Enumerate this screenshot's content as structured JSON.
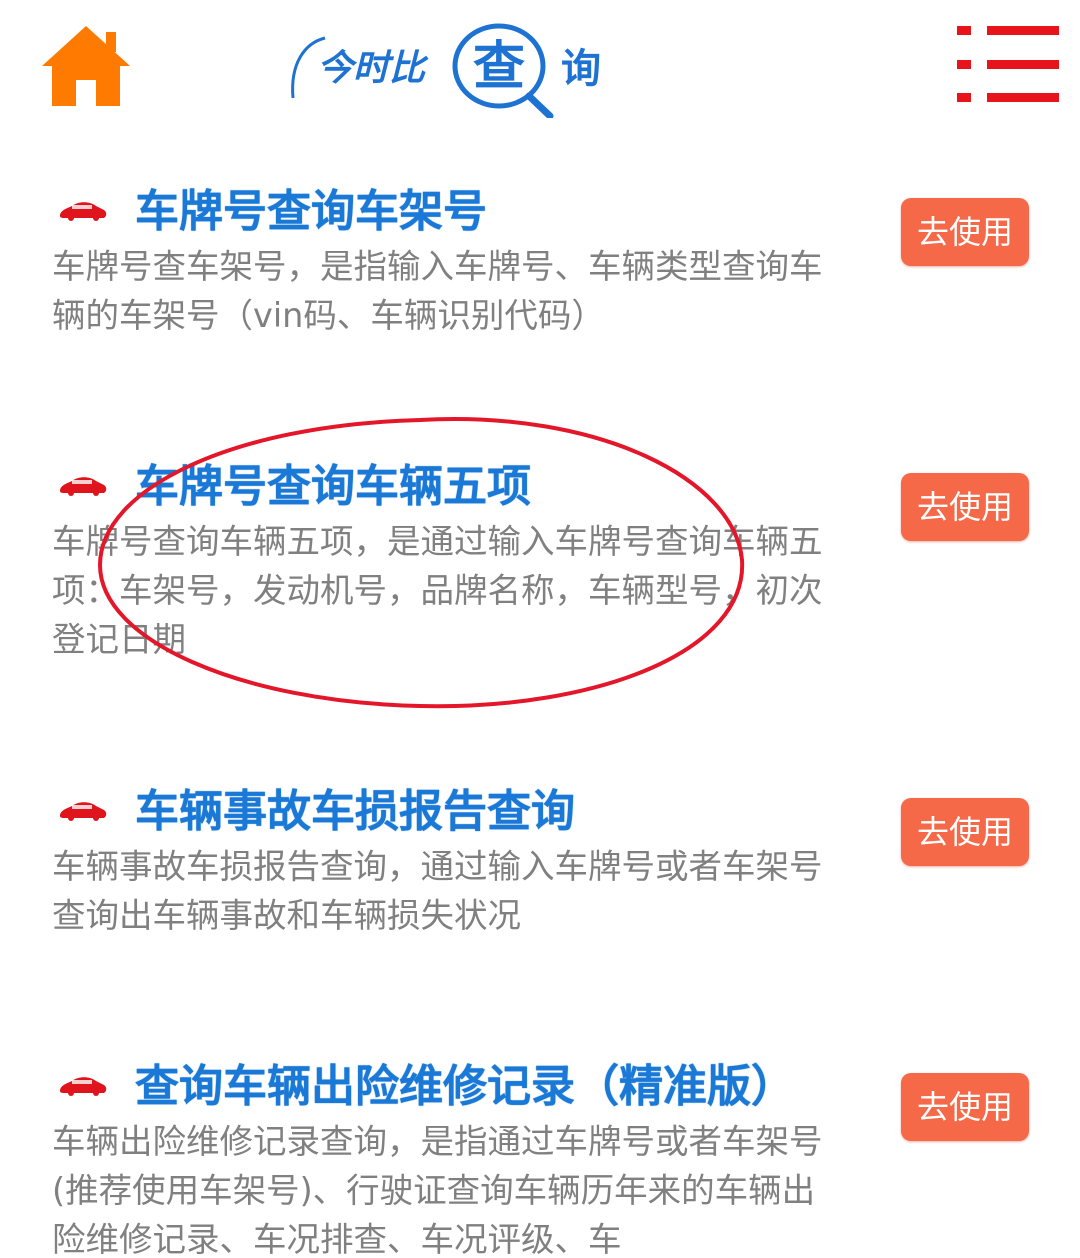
{
  "header": {
    "home_icon": "home-icon",
    "logo": {
      "prefix": "今时比",
      "emblem": "查",
      "suffix": "询"
    },
    "menu_icon": "list-menu-icon"
  },
  "colors": {
    "home": "#ff7a00",
    "logo": "#1e73d2",
    "menu": "#e8141c",
    "title": "#1a78d6",
    "desc": "#808080",
    "button": "#f56848",
    "car": "#e0141c",
    "annotation_circle": "#e4162a"
  },
  "items": [
    {
      "title": "车牌号查询车架号",
      "desc": "车牌号查车架号，是指输入车牌号、车辆类型查询车辆的车架号（vin码、车辆识别代码）",
      "button": "去使用",
      "icon": "red-car-icon"
    },
    {
      "title": "车牌号查询车辆五项",
      "desc": "车牌号查询车辆五项，是通过输入车牌号查询车辆五项：车架号，发动机号，品牌名称，车辆型号，初次登记日期",
      "button": "去使用",
      "icon": "red-car-icon"
    },
    {
      "title": "车辆事故车损报告查询",
      "desc": "车辆事故车损报告查询，通过输入车牌号或者车架号查询出车辆事故和车辆损失状况",
      "button": "去使用",
      "icon": "red-car-icon"
    },
    {
      "title": "查询车辆出险维修记录（精准版）",
      "desc": "车辆出险维修记录查询，是指通过车牌号或者车架号(推荐使用车架号)、行驶证查询车辆历年来的车辆出险维修记录、车况排查、车况评级、车",
      "button": "去使用",
      "icon": "red-car-icon"
    }
  ]
}
